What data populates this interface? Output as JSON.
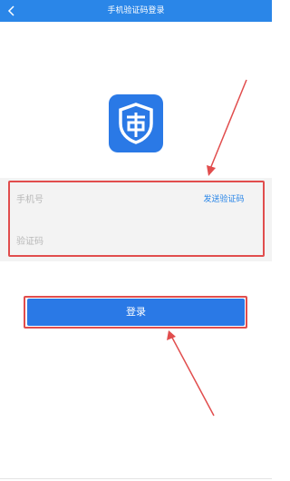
{
  "header": {
    "title": "手机验证码登录",
    "back_icon": "chevron-left-icon"
  },
  "logo": {
    "icon": "shield-app-logo",
    "color": "#2a79e6"
  },
  "form": {
    "phone_placeholder": "手机号",
    "phone_value": "",
    "code_placeholder": "验证码",
    "code_value": "",
    "send_code_label": "发送验证码"
  },
  "login": {
    "label": "登录"
  },
  "colors": {
    "header_bg": "#2a86e8",
    "accent": "#2a79e6",
    "annotation_red": "#e14d4d"
  }
}
